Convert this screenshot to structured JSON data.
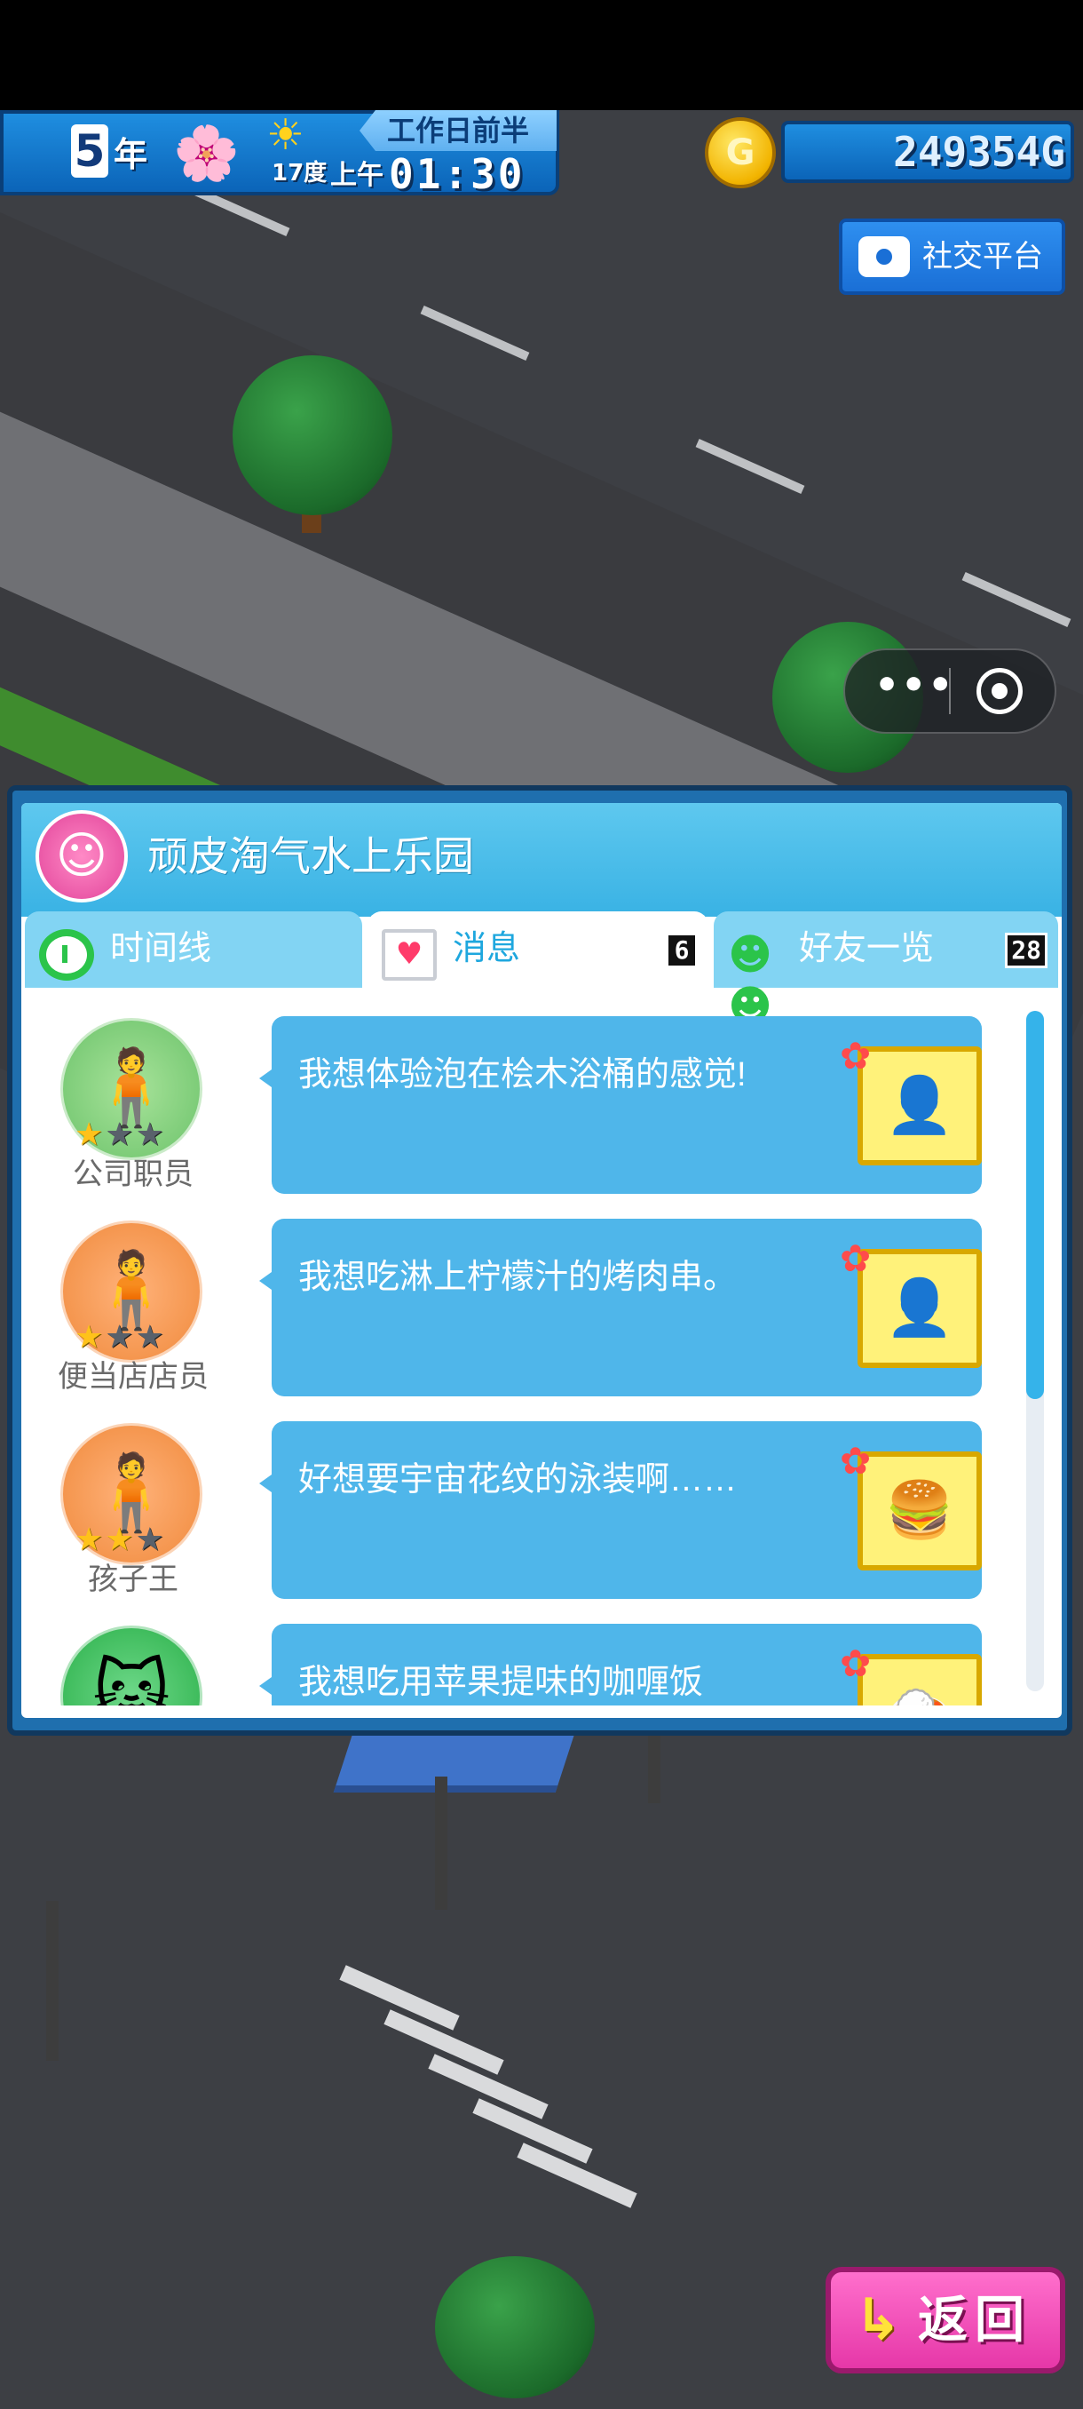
{
  "hud": {
    "year_number": "5",
    "year_label": "年",
    "temperature": "17度",
    "period": "工作日前半",
    "ampm": "上午",
    "time": "01:30",
    "money": "249354G",
    "coin_symbol": "G"
  },
  "social_button": {
    "label": "社交平台",
    "icon": "camera-icon"
  },
  "panel": {
    "park_name": "顽皮淘气水上乐园",
    "tabs": [
      {
        "label": "时间线",
        "icon": "clock-icon"
      },
      {
        "label": "消息",
        "icon": "mail-icon",
        "badge": "6"
      },
      {
        "label": "好友一览",
        "icon": "friends-icon",
        "badge": "28"
      }
    ],
    "messages": [
      {
        "role": "公司职员",
        "stars": 1,
        "text": "我想体验泡在桧木浴桶的感觉!",
        "item_icon": "locked-item-icon",
        "avatar_color": "#6cc36b"
      },
      {
        "role": "便当店店员",
        "stars": 1,
        "text": "我想吃淋上柠檬汁的烤肉串。",
        "item_icon": "locked-item-icon",
        "avatar_color": "#f08a3c"
      },
      {
        "role": "孩子王",
        "stars": 2,
        "text": "好想要宇宙花纹的泳装啊……",
        "item_icon": "burger-icon",
        "avatar_color": "#f08a3c"
      },
      {
        "role": "",
        "stars": 0,
        "text": "我想吃用苹果提味的咖喱饭",
        "item_icon": "food-icon",
        "avatar_color": "#2bb04a"
      }
    ],
    "scroll_fraction": 0.57
  },
  "back_button": {
    "label": "返回"
  },
  "colors": {
    "hud_blue": "#0b64b8",
    "panel_header": "#39b2e4",
    "bubble": "#4fb6ea",
    "back_pink": "#e637a8"
  }
}
